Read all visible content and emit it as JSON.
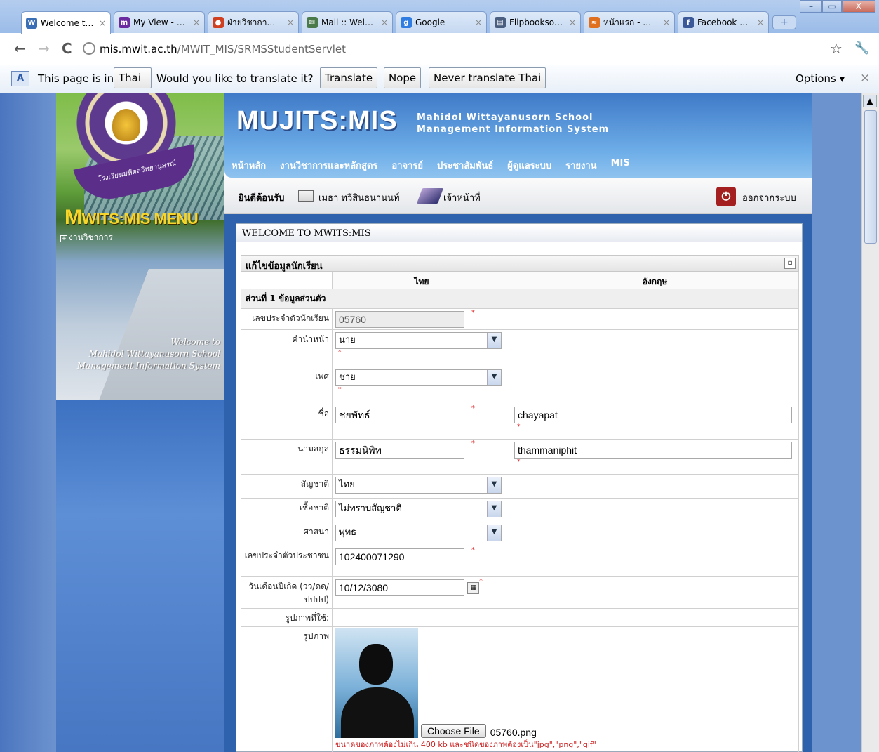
{
  "browser": {
    "tabs": [
      {
        "title": "Welcome t…",
        "favicon_color": "#3a6fb6",
        "favicon_glyph": "W",
        "active": true
      },
      {
        "title": "My View - …",
        "favicon_color": "#6a2aa0",
        "favicon_glyph": "m",
        "active": false
      },
      {
        "title": "ฝ่ายวิชากา…",
        "favicon_color": "#d04020",
        "favicon_glyph": "●",
        "active": false
      },
      {
        "title": "Mail :: Wel…",
        "favicon_color": "#4a7a4a",
        "favicon_glyph": "✉",
        "active": false
      },
      {
        "title": "Google",
        "favicon_color": "#2f7de1",
        "favicon_glyph": "g",
        "active": false
      },
      {
        "title": "Flipbookso…",
        "favicon_color": "#4a5e80",
        "favicon_glyph": "▤",
        "active": false
      },
      {
        "title": "หน้าแรก - …",
        "favicon_color": "#e07020",
        "favicon_glyph": "≈",
        "active": false
      },
      {
        "title": "Facebook …",
        "favicon_color": "#3b5998",
        "favicon_glyph": "f",
        "active": false
      }
    ],
    "tab_close_glyph": "×",
    "new_tab_glyph": "+",
    "window_buttons": {
      "minimize": "–",
      "maximize": "▭",
      "close": "X"
    },
    "back_glyph": "←",
    "forward_glyph": "→",
    "reload_glyph": "C",
    "url_host": "mis.mwit.ac.th",
    "url_path": "/MWIT_MIS/SRMSStudentServlet",
    "star_glyph": "☆",
    "wrench_glyph": "🔧"
  },
  "translate_bar": {
    "icon_glyph": "A",
    "prefix": "This page is in",
    "language": "Thai",
    "question": "Would you like to translate it?",
    "translate_button": "Translate",
    "nope_button": "Nope",
    "never_button": "Never translate Thai",
    "options_label": "Options",
    "close_glyph": "×"
  },
  "site": {
    "logo": "MUJITS:MIS",
    "logo_sub_line1": "Mahidol Wittayanusorn School",
    "logo_sub_line2": "Management Information System",
    "nav": [
      "หน้าหลัก",
      "งานวิชาการและหลักสูตร",
      "อาจารย์",
      "ประชาสัมพันธ์",
      "ผู้ดูแลระบบ",
      "รายงาน",
      "MIS"
    ],
    "ribbon_text": "โรงเรียนมหิดลวิทยานุสรณ์",
    "menu_title_big": "M",
    "menu_title_rest": "WITS:MIS  MENU",
    "menu_items": [
      "งานวิชาการ"
    ],
    "welcome_overlay_line1": "Welcome to",
    "welcome_overlay_line2": "Mahidol Wittayanusorn School",
    "welcome_overlay_line3": "Management Information System"
  },
  "userbar": {
    "welcome": "ยินดีต้อนรับ",
    "user_name": "เมธา ทวีสินธนานนท์",
    "role": "เจ้าหน้าที่",
    "logout_label": "ออกจากระบบ",
    "logout_glyph": "⏻"
  },
  "panel": {
    "title": "WELCOME TO MWITS:MIS",
    "form_title": "แก้ไขข้อมูลนักเรียน",
    "collapse_glyph": "▫",
    "col_thai": "ไทย",
    "col_english": "อังกฤษ",
    "section1": "ส่วนที่ 1 ข้อมูลส่วนตัว",
    "rows": {
      "student_id": {
        "label": "เลขประจำตัวนักเรียน",
        "value": "05760"
      },
      "prefix": {
        "label": "คำนำหน้า",
        "value": "นาย"
      },
      "gender": {
        "label": "เพศ",
        "value": "ชาย"
      },
      "first_name": {
        "label": "ชื่อ",
        "value_th": "ชยพัทธ์",
        "value_en": "chayapat"
      },
      "last_name": {
        "label": "นามสกุล",
        "value_th": "ธรรมนิพิท",
        "value_en": "thammaniphit"
      },
      "nationality": {
        "label": "สัญชาติ",
        "value": "ไทย"
      },
      "race": {
        "label": "เชื้อชาติ",
        "value": "ไม่ทราบสัญชาติ"
      },
      "religion": {
        "label": "ศาสนา",
        "value": "พุทธ"
      },
      "citizen_id": {
        "label": "เลขประจำตัวประชาชน",
        "value": "102400071290"
      },
      "birthdate": {
        "label": "วันเดือนปีเกิด (วว/ดด/ปปปป)",
        "value": "10/12/3080"
      },
      "current_photo": {
        "label": "รูปภาพที่ใช้:"
      },
      "photo": {
        "label": "รูปภาพ",
        "choose_file": "Choose File",
        "file_name": "05760.png",
        "note": "ขนาดของภาพต้องไม่เกิน 400 kb และชนิดของภาพต้องเป็น\"jpg\",\"png\",\"gif\""
      }
    },
    "required_mark": "*",
    "select_arrow": "▼"
  },
  "scroll_up_glyph": "▲"
}
